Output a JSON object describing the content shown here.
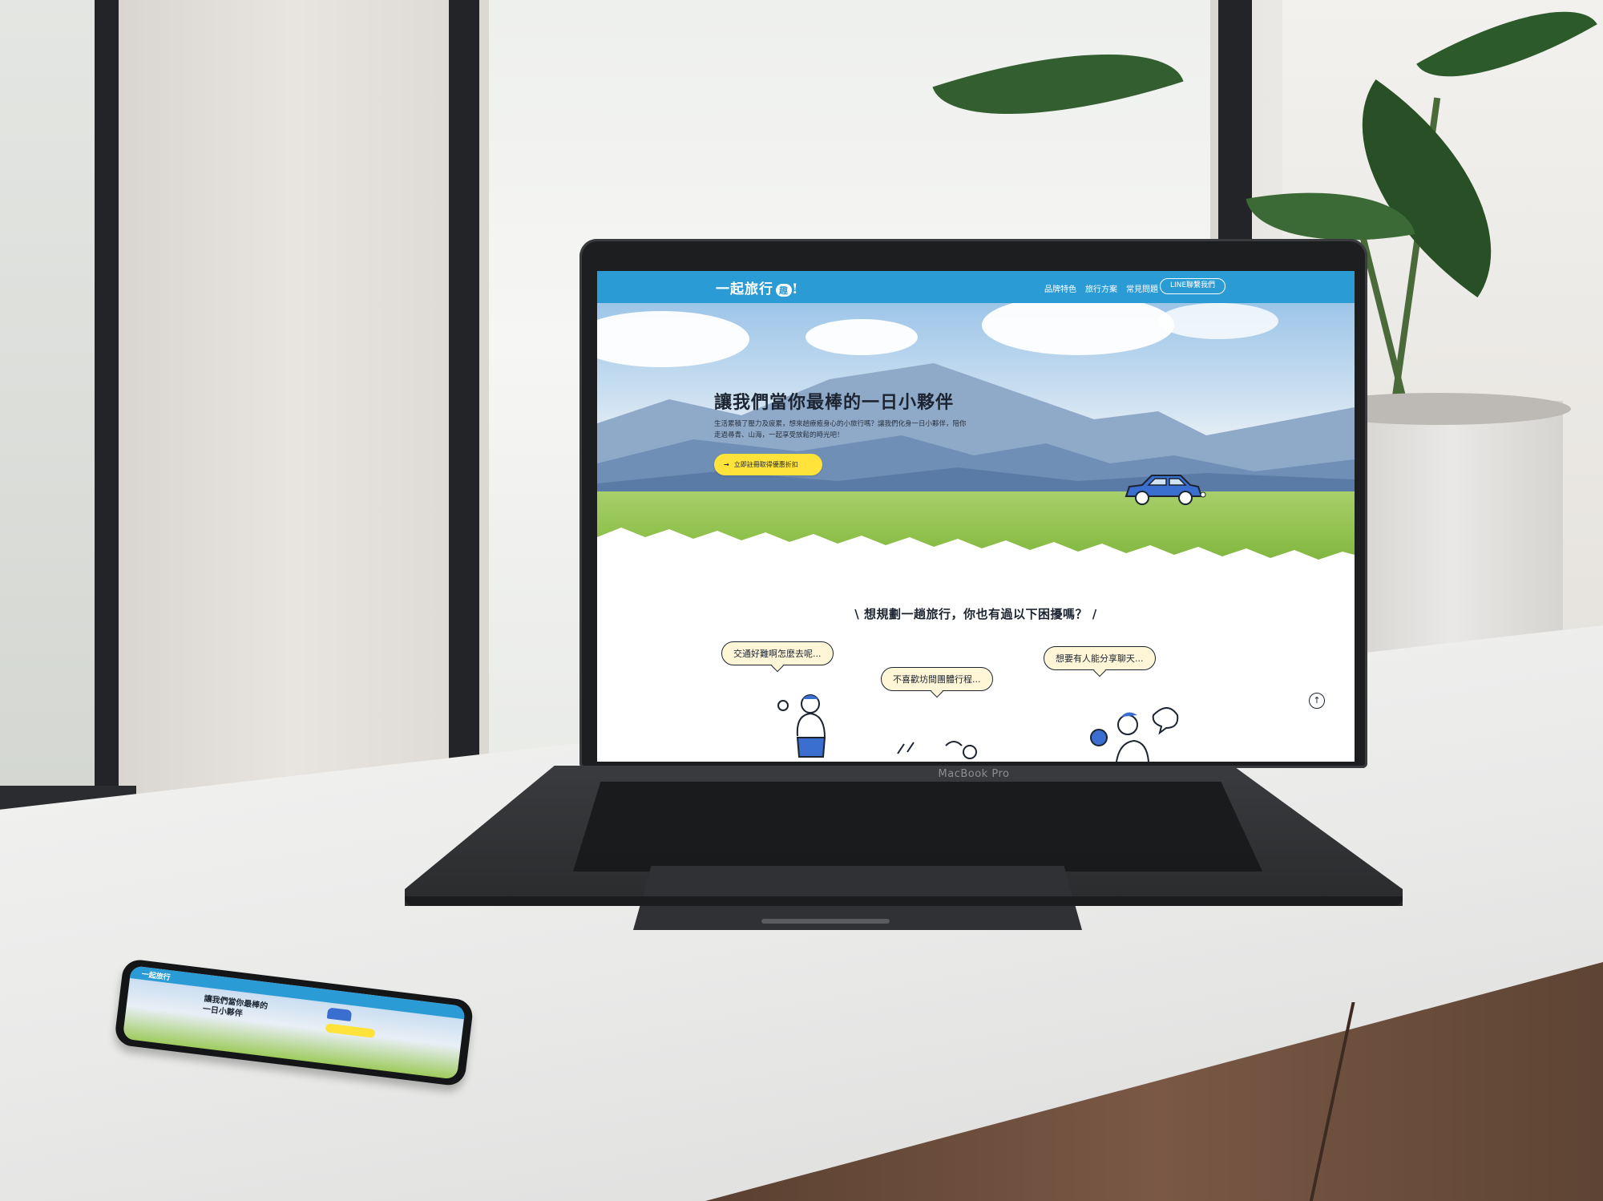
{
  "site": {
    "logo_text": "一起旅行",
    "logo_badge": "趣",
    "logo_suffix": "!",
    "nav": [
      {
        "label": "品牌特色"
      },
      {
        "label": "旅行方案"
      },
      {
        "label": "常見問題"
      }
    ],
    "nav_cta": "LINE聯繫我們",
    "hero_title": "讓我們當你最棒的一日小夥伴",
    "hero_desc": "生活累積了壓力及疲累，想來趟療癒身心的小旅行嗎？讓我們化身一日小夥伴，陪你走過尋青、山海，一起享受放鬆的時光吧！",
    "hero_button": "立即註冊取得優惠折扣",
    "section_title": "想規劃一趟旅行，你也有過以下困擾嗎？",
    "bubbles": [
      {
        "text": "交通好難啊怎麼去呢..."
      },
      {
        "text": "不喜歡坊間團體行程..."
      },
      {
        "text": "想要有人能分享聊天..."
      }
    ],
    "scroll_top_icon": "↑"
  },
  "device": {
    "laptop_label": "MacBook Pro"
  },
  "phone": {
    "logo_text": "一起旅行",
    "title_line1": "讓我們當你最棒的",
    "title_line2": "一日小夥伴"
  },
  "colors": {
    "header_blue": "#2b9bd6",
    "button_yellow": "#ffe23a",
    "bubble_fill": "#fff6d8"
  }
}
